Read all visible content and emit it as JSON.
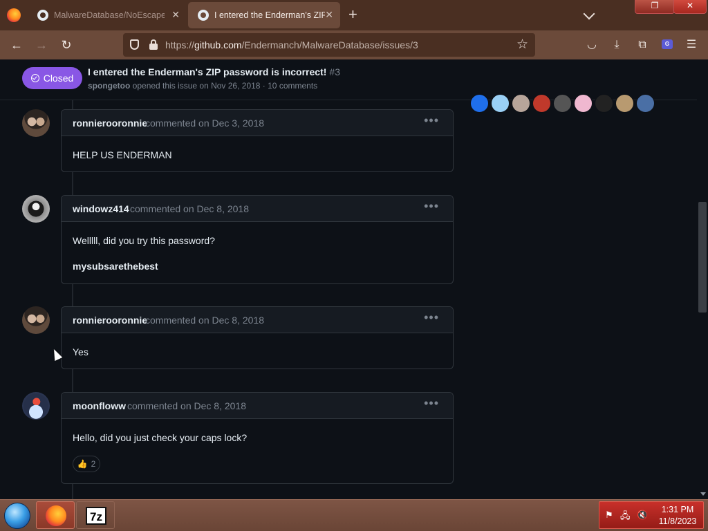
{
  "browser": {
    "tabs": [
      {
        "title": "MalwareDatabase/NoEscape.zip",
        "active": false
      },
      {
        "title": "I entered the Enderman's ZIP password is incorrect!",
        "active": true
      }
    ],
    "url": {
      "scheme": "https://",
      "host": "github.com",
      "path": "/Endermanch/MalwareDatabase/issues/3"
    },
    "icons": {
      "back": "back-arrow-icon",
      "forward": "forward-arrow-icon",
      "reload": "reload-icon",
      "bookmark": "star-icon",
      "pocket": "pocket-icon",
      "downloads": "download-icon",
      "extensions": "puzzle-icon",
      "menu": "hamburger-icon"
    },
    "extension_badge": "G"
  },
  "issue": {
    "state": "Closed",
    "title": "I entered the Enderman's ZIP password is incorrect!",
    "number": "#3",
    "author": "spongetoo",
    "meta_text": "opened this issue on Nov 26, 2018 · 10 comments"
  },
  "participants": [
    {
      "color": "#1f6feb"
    },
    {
      "color": "#9ad0f5"
    },
    {
      "color": "#b7a59a"
    },
    {
      "color": "#c0392b"
    },
    {
      "color": "#555555"
    },
    {
      "color": "#f0b8d0"
    },
    {
      "color": "#222222"
    },
    {
      "color": "#b89a70"
    },
    {
      "color": "#4a6fa5"
    }
  ],
  "comments": [
    {
      "author": "ronnierooronnie",
      "when": "commented on Dec 3, 2018",
      "lines": [
        "HELP US ENDERMAN"
      ]
    },
    {
      "author": "windowz414",
      "when": "commented on Dec 8, 2018",
      "lines": [
        "Welllll, did you try this password?",
        "mysubsarethebest"
      ]
    },
    {
      "author": "ronnierooronnie",
      "when": "commented on Dec 8, 2018",
      "lines": [
        "Yes"
      ]
    },
    {
      "author": "moonfloww",
      "when": "commented on Dec 8, 2018",
      "lines": [
        "Hello, did you just check your caps lock?"
      ],
      "reaction": {
        "emoji": "👍",
        "count": "2"
      }
    }
  ],
  "colors": {
    "closed_state": "#8957e5",
    "page_bg": "#0d1117",
    "browser_chrome": "#6b4a3a",
    "tray": "#c8302a"
  },
  "taskbar": {
    "apps": [
      {
        "name": "Firefox",
        "icon": "firefox-icon"
      },
      {
        "name": "7-Zip",
        "label": "7z",
        "icon": "7zip-icon"
      }
    ],
    "clock_time": "1:31 PM",
    "clock_date": "11/8/2023"
  }
}
